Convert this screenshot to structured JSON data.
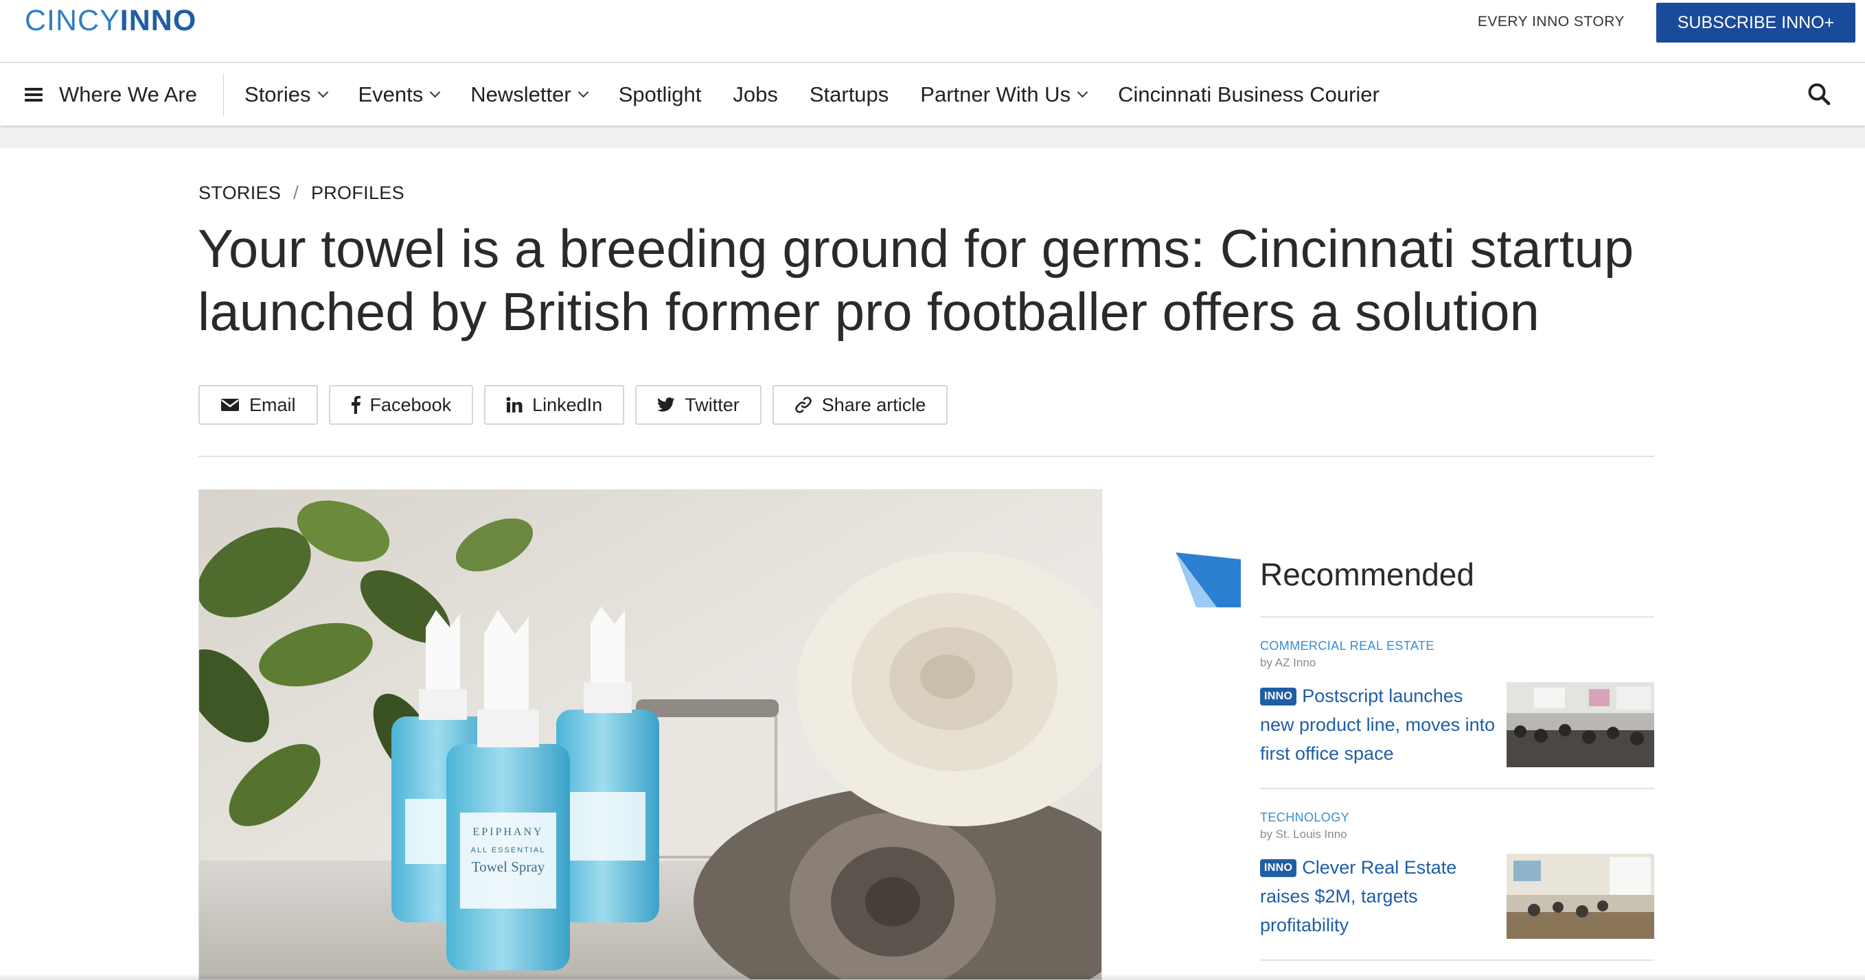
{
  "header": {
    "logo_part1": "CINCY",
    "logo_part2": "INNO",
    "every_story": "EVERY INNO STORY",
    "subscribe": "SUBSCRIBE INNO+"
  },
  "nav": {
    "where": "Where We Are",
    "items": [
      {
        "label": "Stories",
        "dropdown": true
      },
      {
        "label": "Events",
        "dropdown": true
      },
      {
        "label": "Newsletter",
        "dropdown": true
      },
      {
        "label": "Spotlight",
        "dropdown": false
      },
      {
        "label": "Jobs",
        "dropdown": false
      },
      {
        "label": "Startups",
        "dropdown": false
      },
      {
        "label": "Partner With Us",
        "dropdown": true
      },
      {
        "label": "Cincinnati Business Courier",
        "dropdown": false
      }
    ]
  },
  "article": {
    "breadcrumb": [
      "STORIES",
      "PROFILES"
    ],
    "headline": "Your towel is a breeding ground for germs: Cincinnati startup launched by British former pro footballer offers a solution",
    "share": {
      "email": "Email",
      "facebook": "Facebook",
      "linkedin": "LinkedIn",
      "twitter": "Twitter",
      "share_article": "Share article"
    },
    "image_text": {
      "brand": "EPIPHANY",
      "line1": "ALL ESSENTIAL",
      "product": "Towel Spray"
    }
  },
  "recommended": {
    "title": "Recommended",
    "items": [
      {
        "category": "COMMERCIAL REAL ESTATE",
        "byline": "by AZ Inno",
        "badge": "INNO",
        "title": "Postscript launches new product line, moves into first office space"
      },
      {
        "category": "TECHNOLOGY",
        "byline": "by St. Louis Inno",
        "badge": "INNO",
        "title": "Clever Real Estate raises $2M, targets profitability"
      }
    ]
  },
  "colors": {
    "brand_blue": "#1f5ea6",
    "link_blue": "#3a8bd0",
    "subscribe_bg": "#1a4a9a"
  }
}
